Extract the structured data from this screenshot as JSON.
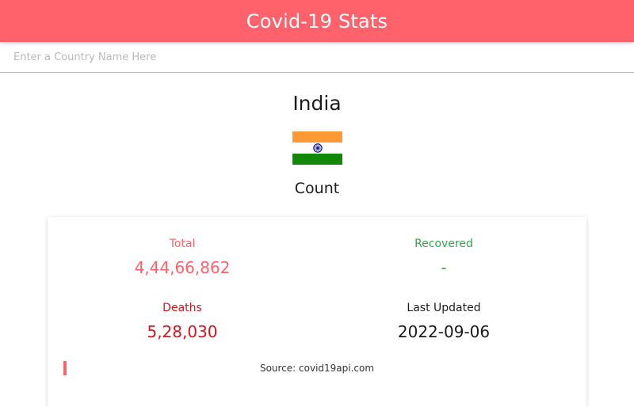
{
  "header": {
    "title": "Covid-19 Stats",
    "bg_color": "#ff626a"
  },
  "search": {
    "placeholder": "Enter a Country Name Here",
    "value": ""
  },
  "country": {
    "name": "India",
    "flag_icon": "india-flag-icon"
  },
  "section_label": "Count",
  "stats": {
    "total": {
      "label": "Total",
      "value": "4,44,66,862",
      "color": "#ff626a"
    },
    "recovered": {
      "label": "Recovered",
      "value": "-",
      "color": "#2ca84a"
    },
    "deaths": {
      "label": "Deaths",
      "value": "5,28,030",
      "color": "#d9121c"
    },
    "last_updated": {
      "label": "Last Updated",
      "value": "2022-09-06"
    }
  },
  "source": {
    "text": "Source: covid19api.com"
  }
}
